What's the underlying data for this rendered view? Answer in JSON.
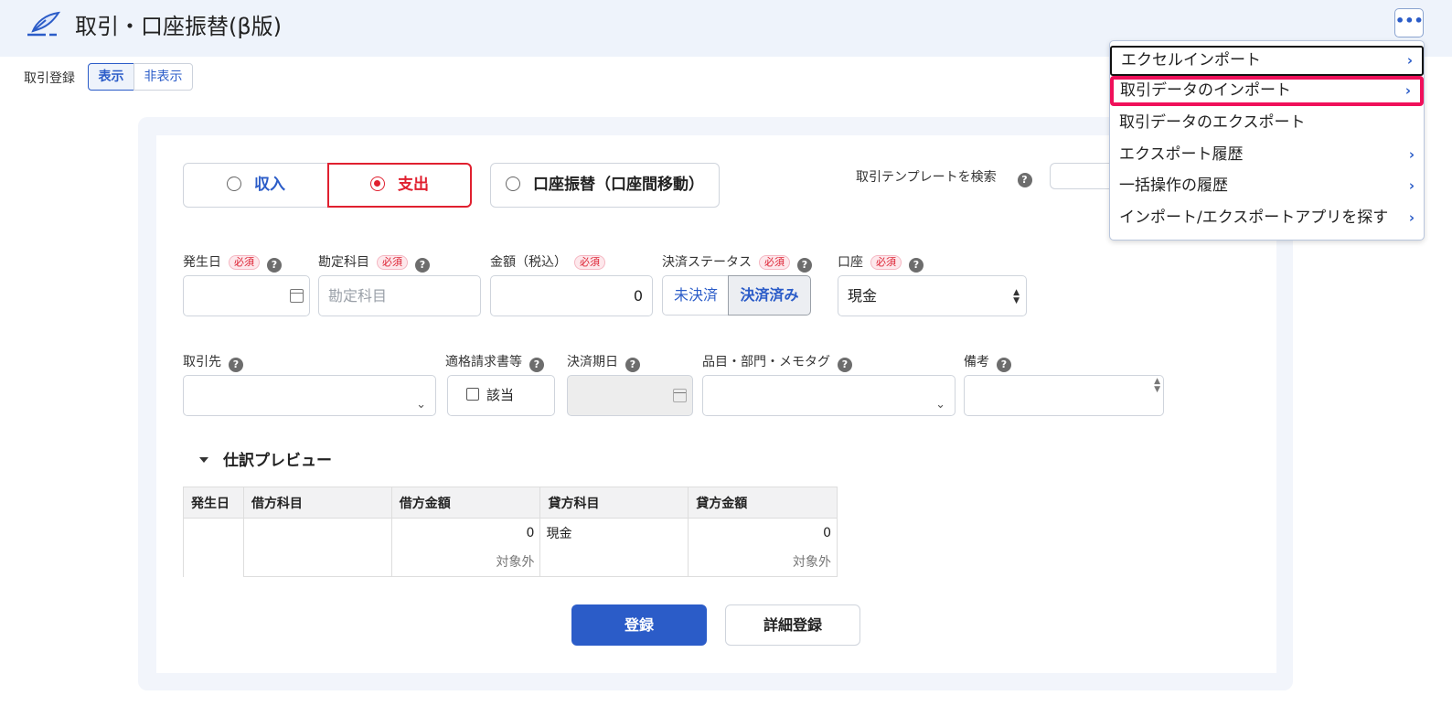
{
  "header": {
    "title": "取引・口座振替(β版)",
    "more_label": "•••"
  },
  "registration": {
    "label": "取引登録",
    "show": "表示",
    "hide": "非表示"
  },
  "type_tabs": {
    "income": "収入",
    "expense": "支出",
    "transfer": "口座振替（口座間移動）",
    "selected": "支出"
  },
  "template": {
    "label": "取引テンプレートを検索",
    "help": "?"
  },
  "fields": {
    "required_badge": "必須",
    "help": "?",
    "date_label": "発生日",
    "account_label": "勘定科目",
    "account_placeholder": "勘定科目",
    "amount_label": "金額（税込）",
    "amount_value": "0",
    "status_label": "決済ステータス",
    "status_unpaid": "未決済",
    "status_paid": "決済済み",
    "wallet_label": "口座",
    "wallet_value": "現金",
    "partner_label": "取引先",
    "invoice_label": "適格請求書等",
    "invoice_checkbox": "該当",
    "due_label": "決済期日",
    "tags_label": "品目・部門・メモタグ",
    "memo_label": "備考"
  },
  "preview": {
    "title": "仕訳プレビュー",
    "headers": [
      "発生日",
      "借方科目",
      "借方金額",
      "貸方科目",
      "貸方金額"
    ],
    "row": {
      "date": "",
      "debit_account": "",
      "debit_amount": "0",
      "credit_account": "現金",
      "credit_amount": "0",
      "debit_tax": "対象外",
      "credit_tax": "対象外"
    }
  },
  "actions": {
    "register": "登録",
    "detail_register": "詳細登録"
  },
  "menu": {
    "items": [
      {
        "label": "エクセルインポート",
        "arrow": "›"
      },
      {
        "label": "取引データのインポート",
        "arrow": "›"
      },
      {
        "label": "取引データのエクスポート",
        "arrow": ""
      },
      {
        "label": "エクスポート履歴",
        "arrow": "›"
      },
      {
        "label": "一括操作の履歴",
        "arrow": "›"
      },
      {
        "label": "インポート/エクスポートアプリを探す",
        "arrow": "›"
      }
    ]
  },
  "colors": {
    "accent": "#2b5cc8",
    "expense_red": "#e0202f",
    "highlight_pink": "#f0105a",
    "header_bg": "#eef3fb"
  }
}
